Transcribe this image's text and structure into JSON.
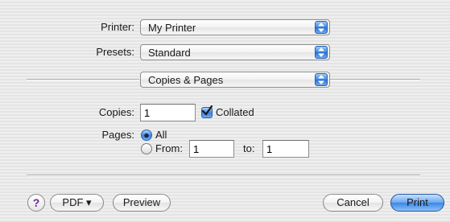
{
  "printer": {
    "label": "Printer:",
    "value": "My Printer"
  },
  "presets": {
    "label": "Presets:",
    "value": "Standard"
  },
  "panel": {
    "value": "Copies & Pages"
  },
  "copies": {
    "label": "Copies:",
    "value": "1",
    "collated_label": "Collated",
    "collated": true
  },
  "pages": {
    "label": "Pages:",
    "all_label": "All",
    "from_label": "From:",
    "from_value": "1",
    "to_label": "to:",
    "to_value": "1",
    "selected": "All"
  },
  "footer": {
    "help_glyph": "?",
    "pdf_label": "PDF ▾",
    "preview_label": "Preview",
    "cancel_label": "Cancel",
    "print_label": "Print"
  },
  "icons": {
    "popup": "up-down-arrows-icon",
    "help": "help-icon",
    "check": "checkmark-icon"
  }
}
